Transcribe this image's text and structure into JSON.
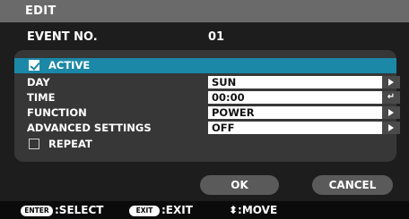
{
  "window": {
    "title": "EDIT"
  },
  "event": {
    "label": "EVENT NO.",
    "value": "01"
  },
  "settings": {
    "active": {
      "label": "ACTIVE",
      "checked": true
    },
    "day": {
      "label": "DAY",
      "value": "SUN"
    },
    "time": {
      "label": "TIME",
      "value": "00:00",
      "enter_glyph": "↵"
    },
    "function": {
      "label": "FUNCTION",
      "value": "POWER"
    },
    "advanced": {
      "label": "ADVANCED SETTINGS",
      "value": "OFF"
    },
    "repeat": {
      "label": "REPEAT",
      "checked": false
    }
  },
  "buttons": {
    "ok": "OK",
    "cancel": "CANCEL"
  },
  "footer": {
    "enter_key": "ENTER",
    "select": ":SELECT",
    "exit_key": "EXIT",
    "exit": ":EXIT",
    "move": "⬍:MOVE"
  },
  "colors": {
    "highlight": "#1b88a7",
    "panel": "#373737",
    "titlebar": "#6a6a6a"
  }
}
